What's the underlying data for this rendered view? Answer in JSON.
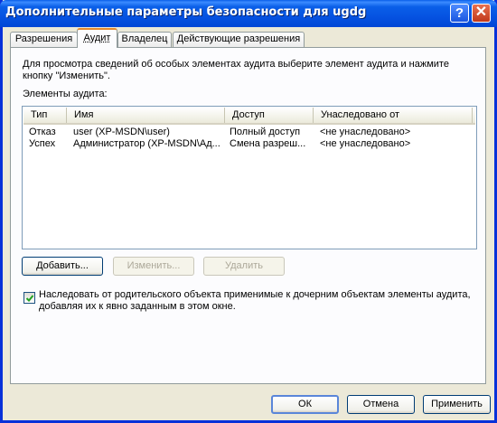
{
  "window": {
    "title": "Дополнительные параметры безопасности для ugdg",
    "help_button": "?",
    "close_button": "✕"
  },
  "tabs": [
    {
      "label": "Разрешения",
      "active": false
    },
    {
      "label": "Аудит",
      "active": true
    },
    {
      "label": "Владелец",
      "active": false
    },
    {
      "label": "Действующие разрешения",
      "active": false
    }
  ],
  "audit": {
    "info_text": "Для просмотра сведений об особых элементах аудита выберите элемент аудита и нажмите кнопку \"Изменить\".",
    "list_label": "Элементы аудита:",
    "columns": [
      "Тип",
      "Имя",
      "Доступ",
      "Унаследовано от"
    ],
    "rows": [
      {
        "type": "Отказ",
        "name": "user (XP-MSDN\\user)",
        "access": "Полный доступ",
        "inherited": "<не унаследовано>"
      },
      {
        "type": "Успех",
        "name": "Администратор (XP-MSDN\\Ад...",
        "access": "Смена разреш...",
        "inherited": "<не унаследовано>"
      }
    ],
    "buttons": {
      "add": "Добавить...",
      "edit": "Изменить...",
      "remove": "Удалить"
    },
    "inherit_checkbox": {
      "checked": true,
      "label": "Наследовать от родительского объекта применимые к дочерним объектам элементы аудита, добавляя их к явно заданным в этом окне."
    }
  },
  "footer": {
    "ok": "ОК",
    "cancel": "Отмена",
    "apply": "Применить"
  },
  "colors": {
    "titlebar": "#0a5fe8",
    "window_bg": "#ece9d8",
    "active_tab_accent": "#e68b2c"
  }
}
